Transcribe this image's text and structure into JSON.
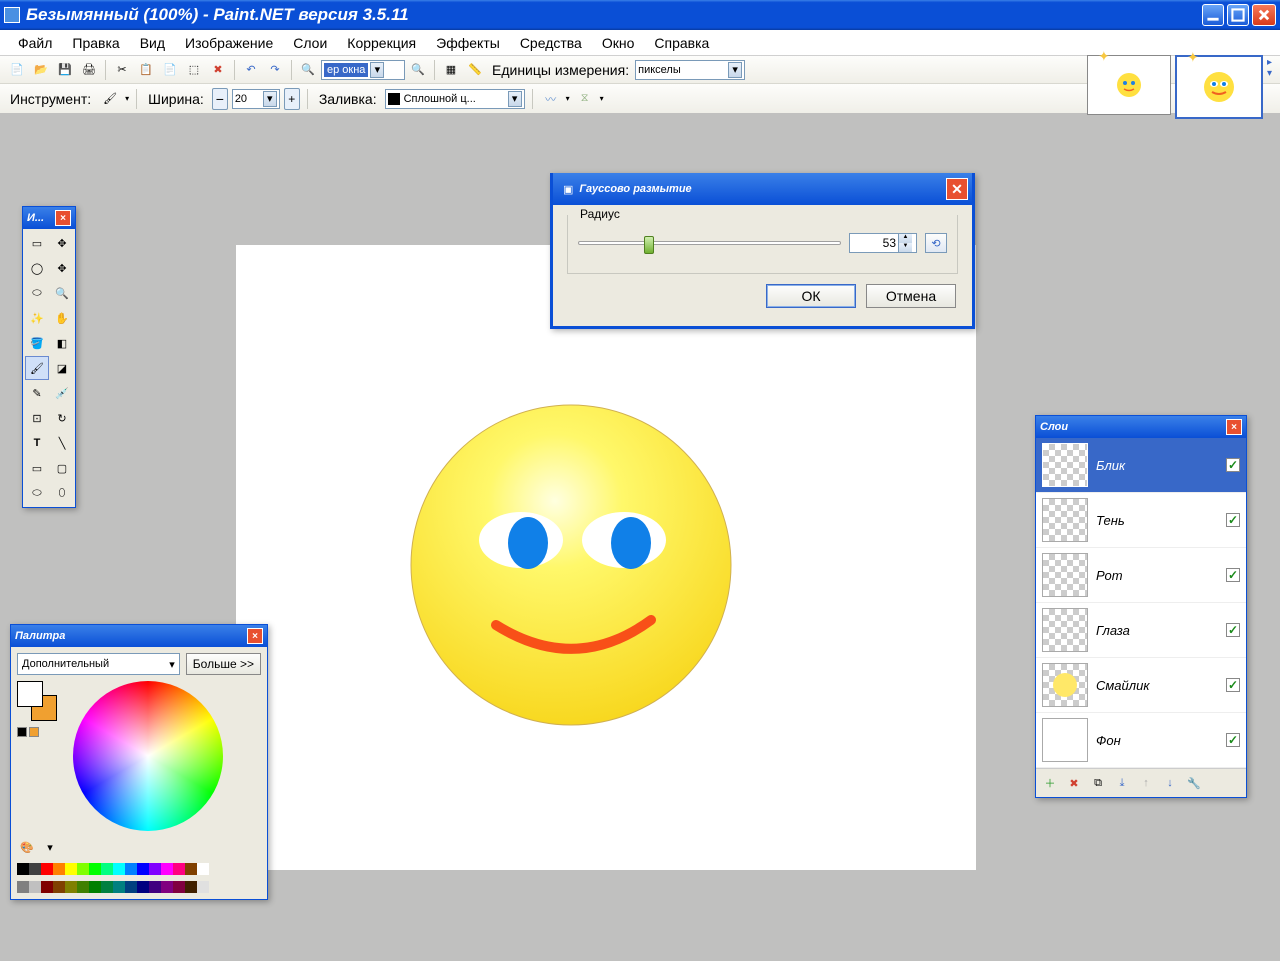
{
  "window": {
    "title": "Безымянный (100%) - Paint.NET версия 3.5.11"
  },
  "menu": {
    "items": [
      "Файл",
      "Правка",
      "Вид",
      "Изображение",
      "Слои",
      "Коррекция",
      "Эффекты",
      "Средства",
      "Окно",
      "Справка"
    ]
  },
  "toolbar": {
    "zoom_text": "ер окна",
    "units_label": "Единицы измерения:",
    "units_value": "пикселы"
  },
  "toolbar2": {
    "tool_label": "Инструмент:",
    "width_label": "Ширина:",
    "width_value": "20",
    "fill_label": "Заливка:",
    "fill_value": "Сплошной ц..."
  },
  "tools_window": {
    "title": "И..."
  },
  "blur_dialog": {
    "title": "Гауссово размытие",
    "radius_label": "Радиус",
    "radius_value": "53",
    "ok": "ОК",
    "cancel": "Отмена"
  },
  "layers_window": {
    "title": "Слои",
    "layers": [
      {
        "name": "Блик",
        "visible": true,
        "selected": true
      },
      {
        "name": "Тень",
        "visible": true,
        "selected": false
      },
      {
        "name": "Рот",
        "visible": true,
        "selected": false
      },
      {
        "name": "Глаза",
        "visible": true,
        "selected": false
      },
      {
        "name": "Смайлик",
        "visible": true,
        "selected": false
      },
      {
        "name": "Фон",
        "visible": true,
        "selected": false
      }
    ]
  },
  "palette_window": {
    "title": "Палитра",
    "mode": "Дополнительный",
    "more": "Больше >>",
    "primary_color": "#ffffff",
    "secondary_color": "#f0a030",
    "swatches": [
      "#000000",
      "#404040",
      "#ff0000",
      "#ff8000",
      "#ffff00",
      "#80ff00",
      "#00ff00",
      "#00ff80",
      "#00ffff",
      "#0080ff",
      "#0000ff",
      "#8000ff",
      "#ff00ff",
      "#ff0080",
      "#804000",
      "#ffffff"
    ]
  }
}
